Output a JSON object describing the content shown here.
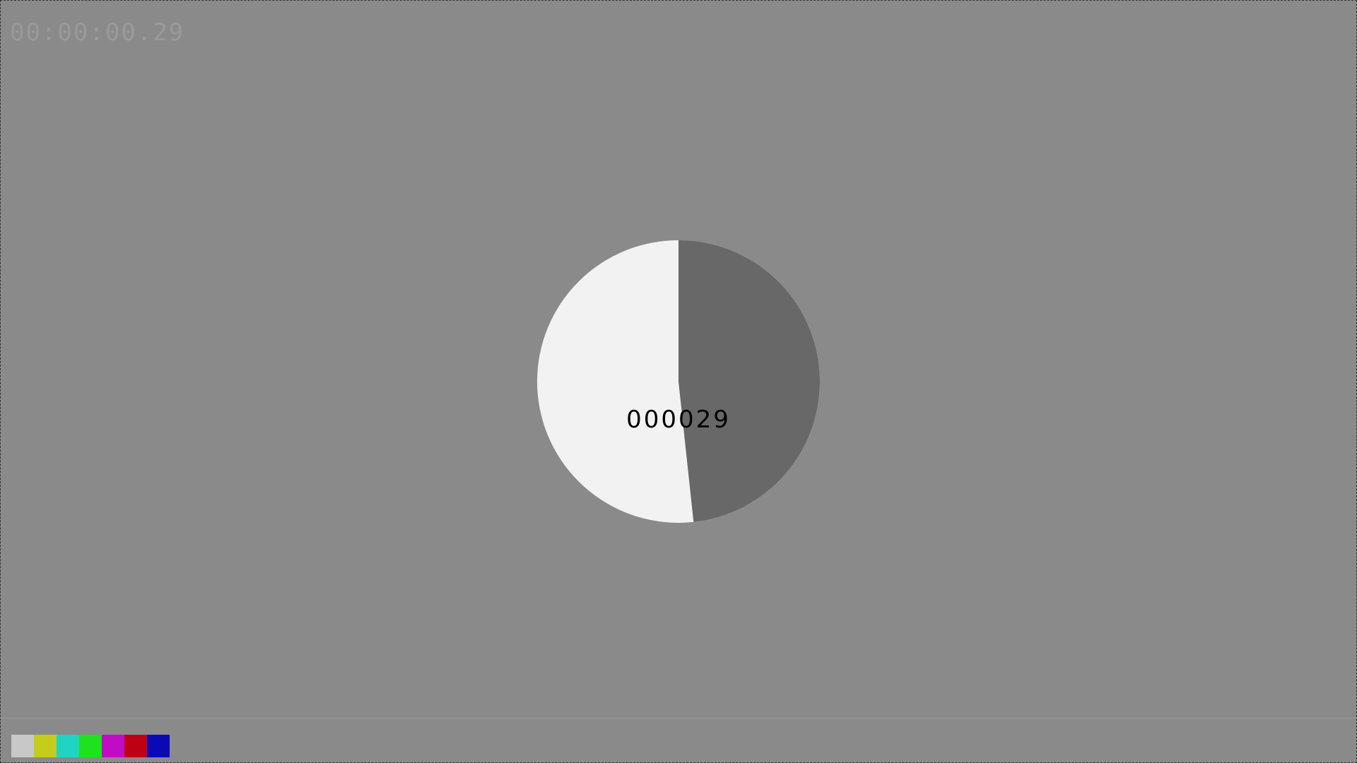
{
  "timecode": "00:00:00.29",
  "frame_counter": "000029",
  "dial": {
    "progress_fraction": 0.483,
    "sweep_color": "#686868",
    "face_color": "#f2f2f2"
  },
  "background_color": "#8a8a8a",
  "color_bars": [
    {
      "name": "gray",
      "color": "#c8c8c8"
    },
    {
      "name": "yellow",
      "color": "#c4cc1c"
    },
    {
      "name": "cyan",
      "color": "#20d4c4"
    },
    {
      "name": "green",
      "color": "#1ee21e"
    },
    {
      "name": "magenta",
      "color": "#c00cc4"
    },
    {
      "name": "red",
      "color": "#be0014"
    },
    {
      "name": "blue",
      "color": "#0a0ab4"
    }
  ]
}
